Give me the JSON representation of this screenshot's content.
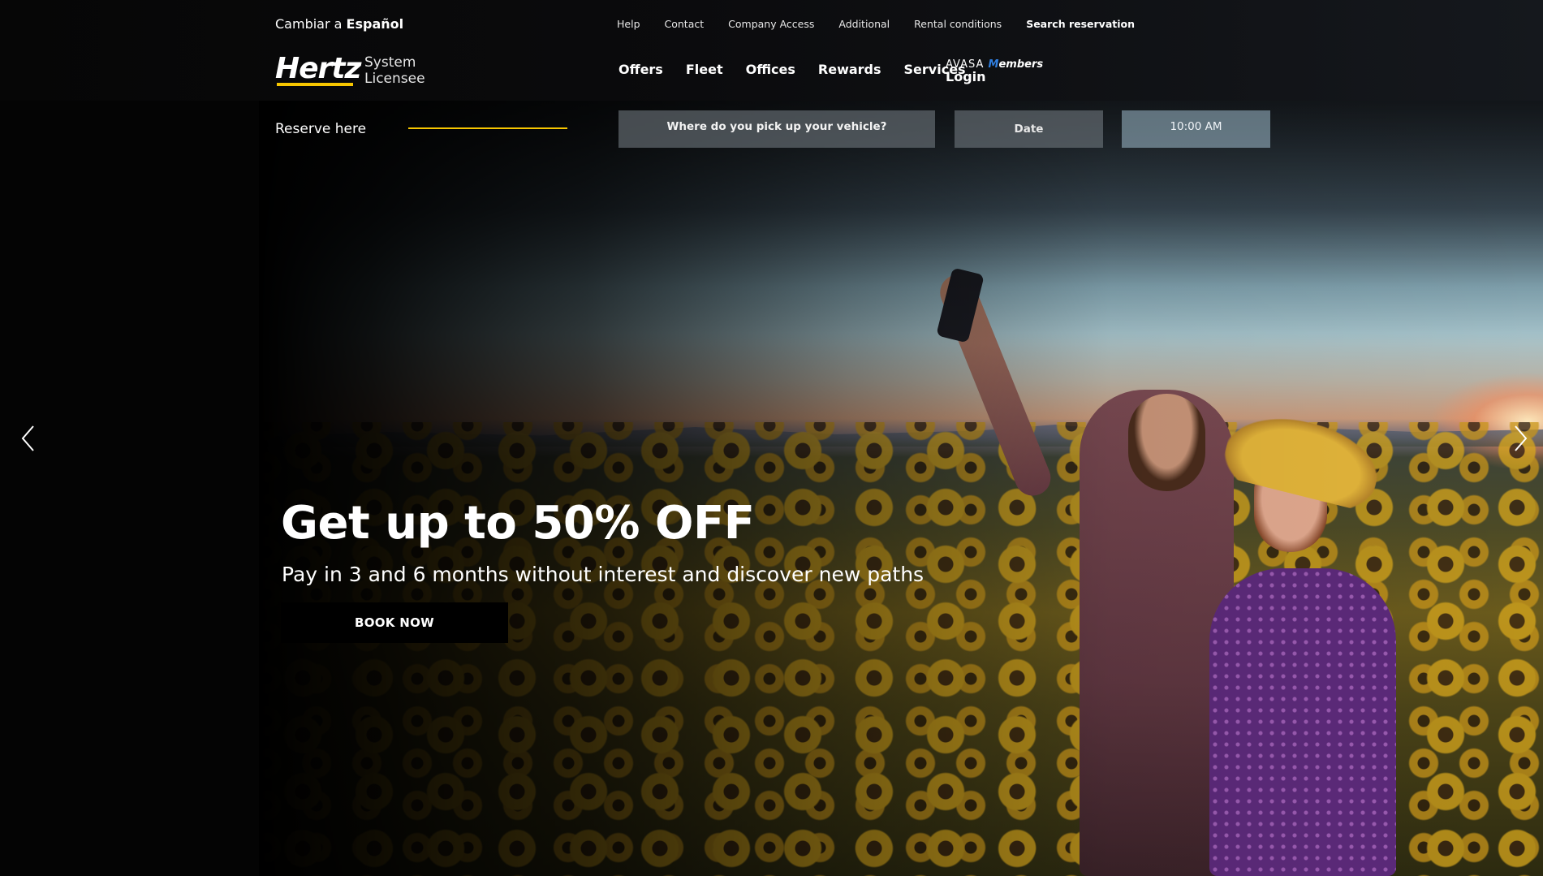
{
  "header": {
    "lang_prefix": "Cambiar a ",
    "lang_target": "Español",
    "top_links": [
      "Help",
      "Contact",
      "Company Access",
      "Additional",
      "Rental conditions",
      "Search reservation"
    ],
    "logo": {
      "brand": "Hertz",
      "line1": "System",
      "line2": "Licensee"
    },
    "nav": [
      "Offers",
      "Fleet",
      "Offices",
      "Rewards",
      "Services"
    ],
    "avasa": {
      "brand": "AVASA",
      "members_lead": "M",
      "members_rest": "embers",
      "login": "Login"
    }
  },
  "reserve": {
    "label": "Reserve here",
    "location_placeholder": "Where do you pick up your vehicle?",
    "date_placeholder": "Date",
    "time_value": "10:00 AM"
  },
  "hero": {
    "title": "Get up to 50% OFF",
    "subtitle": "Pay in 3 and 6 months without interest and discover new paths",
    "cta": "BOOK NOW"
  },
  "carousel": {
    "prev_icon": "chevron-left-icon",
    "next_icon": "chevron-right-icon"
  },
  "colors": {
    "accent": "#f7c600",
    "members_blue": "#2f7fe0"
  }
}
